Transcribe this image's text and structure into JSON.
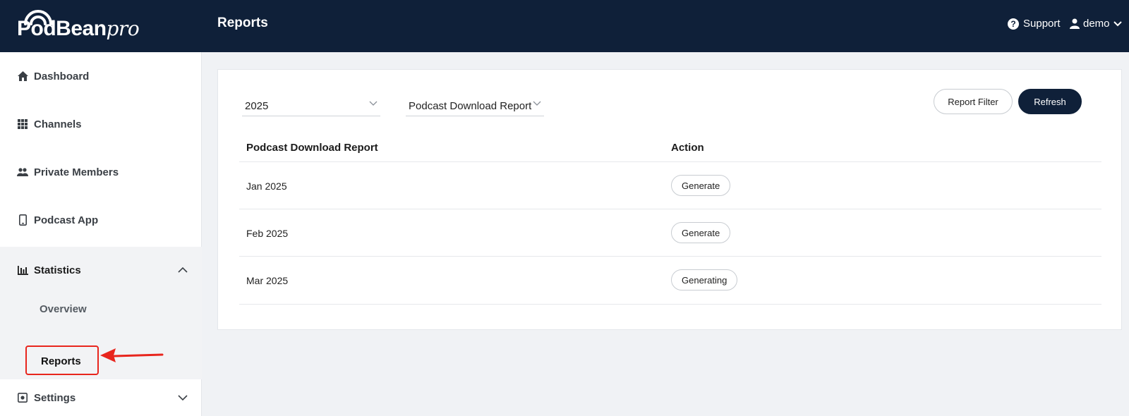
{
  "header": {
    "logo_main": "PodBean",
    "logo_suffix": "pro",
    "page_title": "Reports",
    "support_label": "Support",
    "user_label": "demo"
  },
  "sidebar": {
    "items": [
      {
        "label": "Dashboard",
        "icon": "home-icon"
      },
      {
        "label": "Channels",
        "icon": "grid-icon"
      },
      {
        "label": "Private Members",
        "icon": "members-icon"
      },
      {
        "label": "Podcast App",
        "icon": "phone-icon"
      },
      {
        "label": "Statistics",
        "icon": "bar-chart-icon"
      },
      {
        "label": "Settings",
        "icon": "settings-icon"
      }
    ],
    "statistics_sub": [
      {
        "label": "Overview"
      },
      {
        "label": "Reports"
      }
    ]
  },
  "filters": {
    "year": "2025",
    "report_type": "Podcast Download Report",
    "report_filter_label": "Report Filter",
    "refresh_label": "Refresh"
  },
  "table": {
    "headers": [
      "Podcast Download Report",
      "Action"
    ],
    "rows": [
      {
        "month": "Jan 2025",
        "action": "Generate"
      },
      {
        "month": "Feb 2025",
        "action": "Generate"
      },
      {
        "month": "Mar 2025",
        "action": "Generating"
      }
    ]
  },
  "colors": {
    "header_bg": "#0f2039",
    "highlight": "#e8251d",
    "sidebar_group_bg": "#f2f3f5"
  }
}
